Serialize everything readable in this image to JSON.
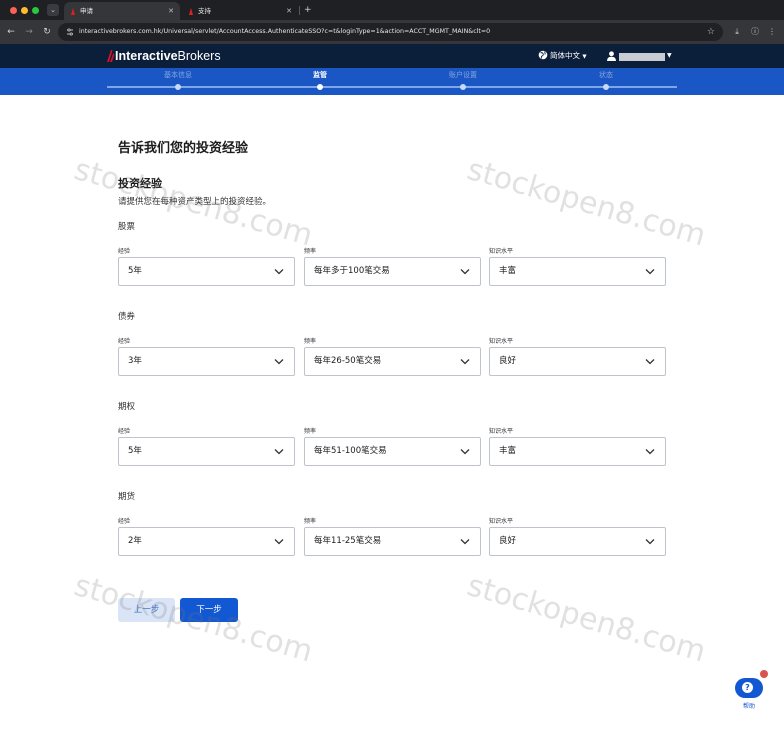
{
  "browser": {
    "tabs": [
      {
        "label": "申请",
        "active": true
      },
      {
        "label": "支持",
        "active": false
      }
    ],
    "url": "interactivebrokers.com.hk/Universal/servlet/AccountAccess.AuthenticateSSO?c=t&loginType=1&action=ACCT_MGMT_MAIN&clt=0"
  },
  "header": {
    "logo_bold": "Interactive",
    "logo_light": "Brokers",
    "language": "简体中文",
    "brand_color": "#d81222"
  },
  "steps": [
    {
      "label": "基本信息",
      "current": false
    },
    {
      "label": "监管",
      "current": true
    },
    {
      "label": "账户设置",
      "current": false
    },
    {
      "label": "状态",
      "current": false
    }
  ],
  "form": {
    "page_title": "告诉我们您的投资经验",
    "section_title": "投资经验",
    "section_desc": "请提供您在每种资产类型上的投资经验。",
    "field_labels": {
      "experience": "经验",
      "frequency": "频率",
      "knowledge": "知识水平"
    },
    "assets": [
      {
        "name": "股票",
        "experience": "5年",
        "frequency": "每年多于100笔交易",
        "knowledge": "丰富"
      },
      {
        "name": "债券",
        "experience": "3年",
        "frequency": "每年26-50笔交易",
        "knowledge": "良好"
      },
      {
        "name": "期权",
        "experience": "5年",
        "frequency": "每年51-100笔交易",
        "knowledge": "丰富"
      },
      {
        "name": "期货",
        "experience": "2年",
        "frequency": "每年11-25笔交易",
        "knowledge": "良好"
      }
    ],
    "prev_button": "上一步",
    "next_button": "下一步"
  },
  "watermark": "stockopen8.com",
  "help": {
    "label": "帮助",
    "icon": "?"
  }
}
